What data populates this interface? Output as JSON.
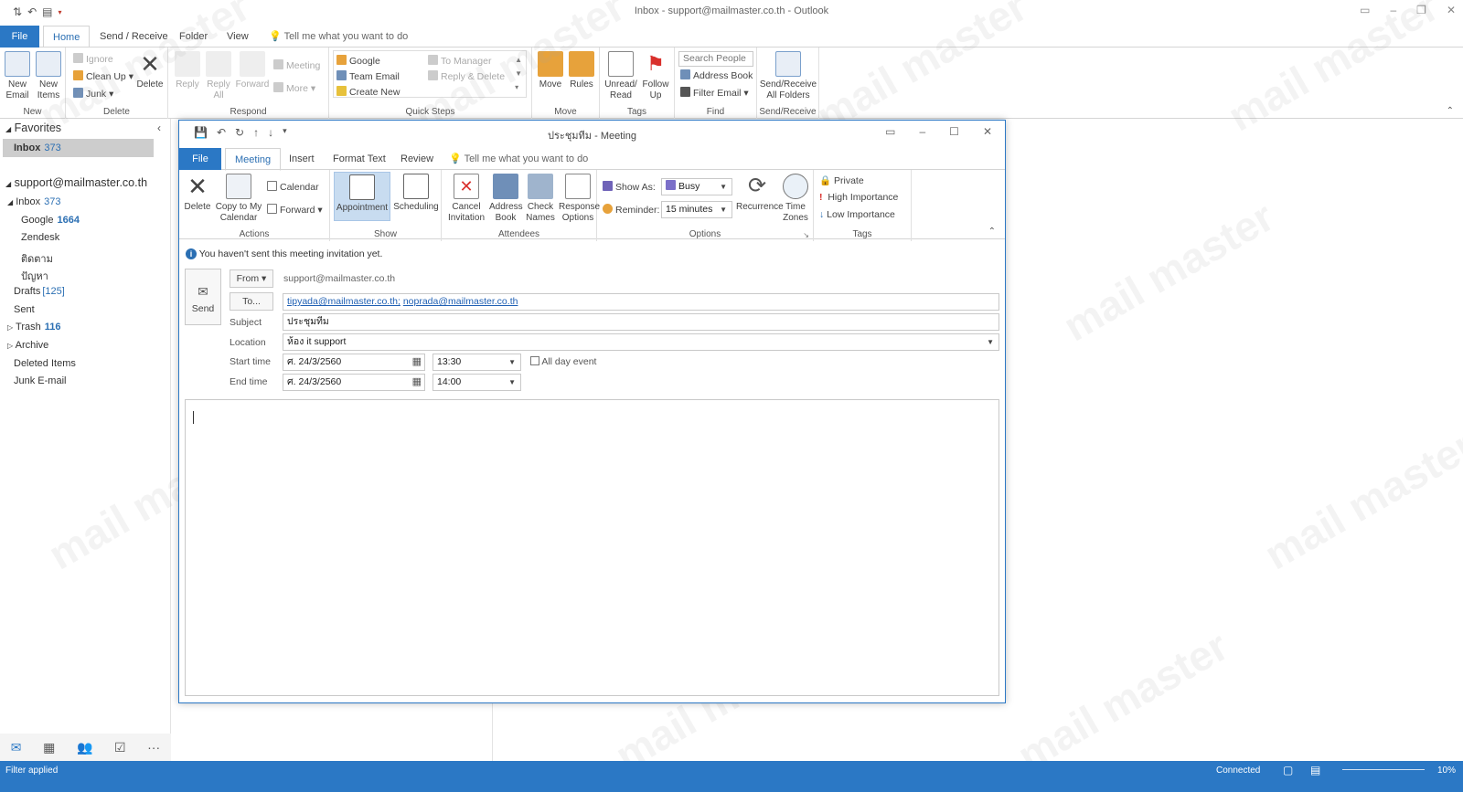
{
  "window": {
    "title": "Inbox - support@mailmaster.co.th - Outlook"
  },
  "tabs": [
    "File",
    "Home",
    "Send / Receive",
    "Folder",
    "View"
  ],
  "tell_me": "Tell me what you want to do",
  "ribbon": {
    "new_email": "New\nEmail",
    "new_items": "New\nItems",
    "group_new": "New",
    "ignore": "Ignore",
    "clean_up": "Clean Up",
    "junk": "Junk",
    "delete": "Delete",
    "group_delete": "Delete",
    "reply": "Reply",
    "reply_all": "Reply\nAll",
    "forward": "Forward",
    "meeting": "Meeting",
    "more": "More",
    "group_respond": "Respond",
    "qs_google": "Google",
    "qs_team_email": "Team Email",
    "qs_create_new": "Create New",
    "qs_to_manager": "To Manager",
    "qs_reply_delete": "Reply & Delete",
    "group_quick_steps": "Quick Steps",
    "move": "Move",
    "rules": "Rules",
    "group_move": "Move",
    "unread_read": "Unread/\nRead",
    "follow_up": "Follow\nUp",
    "group_tags": "Tags",
    "search_people": "Search People",
    "address_book": "Address Book",
    "filter_email": "Filter Email",
    "group_find": "Find",
    "send_receive_all": "Send/Receive\nAll Folders",
    "group_send_receive": "Send/Receive"
  },
  "nav": {
    "favorites": "Favorites",
    "fav_inbox": "Inbox",
    "fav_inbox_count": "373",
    "account": "support@mailmaster.co.th",
    "folders": [
      {
        "label": "Inbox",
        "count": "373"
      },
      {
        "label": "Google",
        "count": "1664"
      },
      {
        "label": "Zendesk",
        "count": ""
      },
      {
        "label": "ติดตาม",
        "count": ""
      },
      {
        "label": "ปัญหา",
        "count": ""
      },
      {
        "label": "Drafts",
        "count": "[125]"
      },
      {
        "label": "Sent",
        "count": ""
      },
      {
        "label": "Trash",
        "count": "116"
      },
      {
        "label": "Archive",
        "count": ""
      },
      {
        "label": "Deleted Items",
        "count": ""
      },
      {
        "label": "Junk E-mail",
        "count": ""
      }
    ]
  },
  "status": {
    "left": "Filter applied",
    "connected": "Connected",
    "zoom": "10%"
  },
  "meeting": {
    "title": "ประชุมทีม  -  Meeting",
    "tabs": [
      "File",
      "Meeting",
      "Insert",
      "Format Text",
      "Review"
    ],
    "tell_me": "Tell me what you want to do",
    "ribbon": {
      "delete": "Delete",
      "copy_to_calendar": "Copy to My\nCalendar",
      "calendar": "Calendar",
      "forward": "Forward",
      "group_actions": "Actions",
      "appointment": "Appointment",
      "scheduling": "Scheduling",
      "group_show": "Show",
      "cancel_invitation": "Cancel\nInvitation",
      "address_book": "Address\nBook",
      "check_names": "Check\nNames",
      "response_options": "Response\nOptions",
      "group_attendees": "Attendees",
      "show_as_label": "Show As:",
      "show_as_value": "Busy",
      "reminder_label": "Reminder:",
      "reminder_value": "15 minutes",
      "recurrence": "Recurrence",
      "time_zones": "Time\nZones",
      "group_options": "Options",
      "private": "Private",
      "high_importance": "High Importance",
      "low_importance": "Low Importance",
      "group_tags": "Tags"
    },
    "info": "You haven't sent this meeting invitation yet.",
    "send": "Send",
    "from_btn": "From",
    "from_value": "support@mailmaster.co.th",
    "to_btn": "To...",
    "to_1": "tipyada@mailmaster.co.th;",
    "to_2": "noprada@mailmaster.co.th",
    "subject_label": "Subject",
    "subject_value": "ประชุมทีม",
    "location_label": "Location",
    "location_value": "ห้อง it support",
    "start_label": "Start time",
    "start_date": "ศ. 24/3/2560",
    "start_time": "13:30",
    "all_day": "All day event",
    "end_label": "End time",
    "end_date": "ศ. 24/3/2560",
    "end_time": "14:00"
  }
}
